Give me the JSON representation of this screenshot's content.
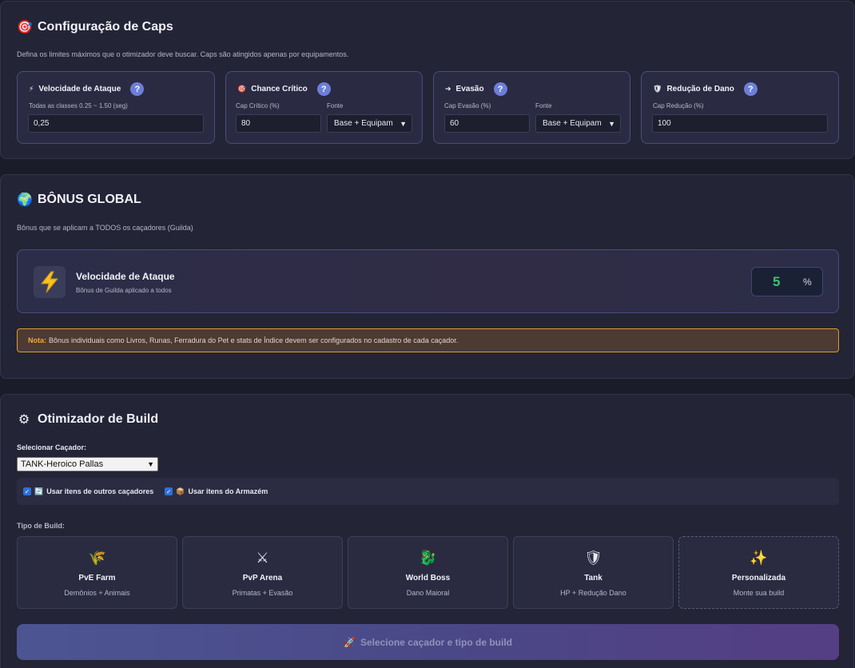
{
  "caps": {
    "title": "Configuração de Caps",
    "icon": "target-icon",
    "description": "Defina os limites máximos que o otimizador deve buscar. Caps são atingidos apenas por equipamentos.",
    "cards": [
      {
        "title": "Velocidade de Ataque",
        "icon": "lightning-icon",
        "label": "Todas as classes 0.25 ~ 1.50 (seg)",
        "value": "0,25"
      },
      {
        "title": "Chance Crítico",
        "icon": "target-icon",
        "label": "Cap Crítico (%)",
        "value": "80",
        "source_label": "Fonte",
        "source_value": "Base + Equipam"
      },
      {
        "title": "Evasão",
        "icon": "arrow-icon",
        "label": "Cap Evasão (%)",
        "value": "60",
        "source_label": "Fonte",
        "source_value": "Base + Equipam"
      },
      {
        "title": "Redução de Dano",
        "icon": "shield-icon",
        "label": "Cap Redução (%)",
        "value": "100"
      }
    ],
    "help": "?"
  },
  "bonus": {
    "title": "BÔNUS GLOBAL",
    "icon": "globe-icon",
    "description": "Bônus que se aplicam a TODOS os caçadores (Guilda)",
    "card_title": "Velocidade de Ataque",
    "card_sub": "Bônus de Guilda aplicado a todos",
    "value": "5",
    "unit": "%",
    "note_label": "Nota:",
    "note_text": "Bônus individuais como Livros, Runas, Ferradura do Pet e stats de Índice devem ser configurados no cadastro de cada caçador."
  },
  "optimizer": {
    "title": "Otimizador de Build",
    "icon": "gear-icon",
    "select_label": "Selecionar Caçador:",
    "selected_hunter": "TANK-Heroico Pallas",
    "check_other": "Usar itens de outros caçadores",
    "check_storage": "Usar itens do Armazém",
    "build_type_label": "Tipo de Build:",
    "builds": [
      {
        "name": "PvE Farm",
        "desc": "Demônios + Animais",
        "icon": "wheat-icon"
      },
      {
        "name": "PvP Arena",
        "desc": "Primatas + Evasão",
        "icon": "crossed-swords-icon"
      },
      {
        "name": "World Boss",
        "desc": "Dano Maioral",
        "icon": "dragon-icon"
      },
      {
        "name": "Tank",
        "desc": "HP + Redução Dano",
        "icon": "shield-icon"
      },
      {
        "name": "Personalizada",
        "desc": "Monte sua build",
        "icon": "sparkles-icon"
      }
    ],
    "button_label": "Selecione caçador e tipo de build",
    "button_icon": "rocket-icon"
  },
  "colors": {
    "accent": "#6c7fd8",
    "success": "#3ec46d",
    "warning": "#e19a2c"
  }
}
